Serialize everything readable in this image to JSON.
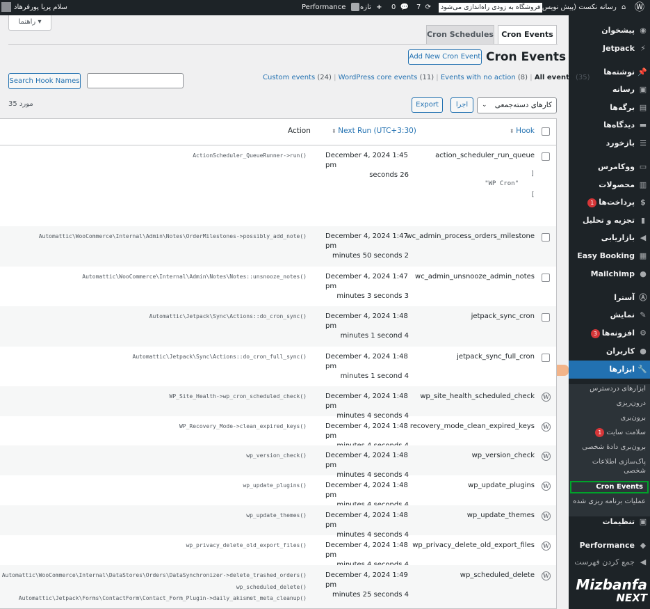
{
  "admin_bar": {
    "greeting": "سلام پریا پورفرهاد",
    "performance": "Performance",
    "new_label": "تازه",
    "comments_count": "0",
    "updates_count": "7",
    "notice": "فروشگاه به زودی راه‌اندازی می‌شود",
    "site_name": "رسانه نکست (پیش نویس)"
  },
  "menu": {
    "items": [
      {
        "label": "پیشخوان",
        "icon": "dashboard-icon"
      },
      {
        "label": "Jetpack",
        "icon": "jetpack-icon"
      },
      {
        "label": "نوشته‌ها",
        "icon": "pin-icon"
      },
      {
        "label": "رسانه",
        "icon": "media-icon"
      },
      {
        "label": "برگه‌ها",
        "icon": "pages-icon"
      },
      {
        "label": "دیدگاه‌ها",
        "icon": "comments-icon"
      },
      {
        "label": "بازخورد",
        "icon": "feedback-icon"
      },
      {
        "label": "ووکامرس",
        "icon": "woo-icon"
      },
      {
        "label": "محصولات",
        "icon": "products-icon"
      },
      {
        "label": "پرداخت‌ها",
        "icon": "payments-icon",
        "badge": "1"
      },
      {
        "label": "تجزیه و تحلیل",
        "icon": "analytics-icon"
      },
      {
        "label": "بازاریابی",
        "icon": "marketing-icon"
      },
      {
        "label": "Easy Booking",
        "icon": "calendar-icon"
      },
      {
        "label": "Mailchimp",
        "icon": "mailchimp-icon"
      },
      {
        "label": "آسترا",
        "icon": "astra-icon"
      },
      {
        "label": "نمایش",
        "icon": "brush-icon"
      },
      {
        "label": "افزونه‌ها",
        "icon": "plugins-icon",
        "badge": "3"
      },
      {
        "label": "کاربران",
        "icon": "users-icon"
      },
      {
        "label": "ابزارها",
        "icon": "tools-icon"
      },
      {
        "label": "تنظیمات",
        "icon": "settings-icon"
      },
      {
        "label": "Performance",
        "icon": "performance-icon"
      },
      {
        "label": "جمع کردن فهرست",
        "icon": "collapse-icon"
      }
    ],
    "submenu": [
      {
        "label": "ابزارهای دردسترس"
      },
      {
        "label": "درون‌ریزی"
      },
      {
        "label": "برون‌بری"
      },
      {
        "label": "سلامت سایت",
        "badge": "1"
      },
      {
        "label": "برون‌بری دادهٔ شخصی"
      },
      {
        "label": "پاک‌سازی اطلاعات شخصی"
      },
      {
        "label": "Cron Events"
      },
      {
        "label": "عملیات برنامه ریزی شده"
      }
    ],
    "logo_line1": "Mizbanfa",
    "logo_line2": "NEXT"
  },
  "page": {
    "help_label": "راهنما ▾",
    "tabs": [
      "Cron Events",
      "Cron Schedules"
    ],
    "title": "Cron Events",
    "add_new": "Add New Cron Event",
    "filters": [
      {
        "label": "All events",
        "count": "(35)"
      },
      {
        "label": "Events with no action",
        "count": "(8)"
      },
      {
        "label": "WordPress core events",
        "count": "(11)"
      },
      {
        "label": "Custom events",
        "count": "(24)"
      }
    ],
    "search_button": "Search Hook Names",
    "search_value": "",
    "bulk_select": "کارهای دسته‌جمعی",
    "apply_button": "اجرا",
    "export_button": "Export",
    "items_count": "35 مورد"
  },
  "table": {
    "columns": {
      "hook": "Hook",
      "next_run": "Next Run (UTC+3:30)",
      "action": "Action"
    },
    "args": [
      "]",
      "\"WP Cron\"",
      "["
    ],
    "rows": [
      {
        "hook": "action_scheduler_run_queue",
        "date": "December 4, 2024 1:45 pm",
        "rel": "seconds 26",
        "action": "ActionScheduler_QueueRunner->run()",
        "type": "checkbox"
      },
      {
        "hook": "wc_admin_process_orders_milestone",
        "date": "December 4, 2024 1:47 pm",
        "rel": "minutes 50 seconds 2",
        "action": "Automattic\\WooCommerce\\Internal\\Admin\\Notes\\OrderMilestones->possibly_add_note()",
        "type": "checkbox"
      },
      {
        "hook": "wc_admin_unsnooze_admin_notes",
        "date": "December 4, 2024 1:47 pm",
        "rel": "minutes 3 seconds 3",
        "action": "Automattic\\WooCommerce\\Internal\\Admin\\Notes\\Notes::unsnooze_notes()",
        "type": "checkbox"
      },
      {
        "hook": "jetpack_sync_cron",
        "date": "December 4, 2024 1:48 pm",
        "rel": "minutes 1 second 4",
        "action": "Automattic\\Jetpack\\Sync\\Actions::do_cron_sync()",
        "type": "checkbox"
      },
      {
        "hook": "jetpack_sync_full_cron",
        "date": "December 4, 2024 1:48 pm",
        "rel": "minutes 1 second 4",
        "action": "Automattic\\Jetpack\\Sync\\Actions::do_cron_full_sync()",
        "type": "checkbox"
      },
      {
        "hook": "wp_site_health_scheduled_check",
        "date": "December 4, 2024 1:48 pm",
        "rel": "minutes 4 seconds 4",
        "action": "WP_Site_Health->wp_cron_scheduled_check()",
        "type": "wp"
      },
      {
        "hook": "recovery_mode_clean_expired_keys",
        "date": "December 4, 2024 1:48 pm",
        "rel": "minutes 4 seconds 4",
        "action": "WP_Recovery_Mode->clean_expired_keys()",
        "type": "wp"
      },
      {
        "hook": "wp_version_check",
        "date": "December 4, 2024 1:48 pm",
        "rel": "minutes 4 seconds 4",
        "action": "wp_version_check()",
        "type": "wp"
      },
      {
        "hook": "wp_update_plugins",
        "date": "December 4, 2024 1:48 pm",
        "rel": "minutes 4 seconds 4",
        "action": "wp_update_plugins()",
        "type": "wp"
      },
      {
        "hook": "wp_update_themes",
        "date": "December 4, 2024 1:48 pm",
        "rel": "minutes 4 seconds 4",
        "action": "wp_update_themes()",
        "type": "wp"
      },
      {
        "hook": "wp_privacy_delete_old_export_files",
        "date": "December 4, 2024 1:48 pm",
        "rel": "minutes 4 seconds 4",
        "action": "wp_privacy_delete_old_export_files()",
        "type": "wp"
      },
      {
        "hook": "wp_scheduled_delete",
        "date": "December 4, 2024 1:49 pm",
        "rel": "minutes 25 seconds 4",
        "action": "Automattic\\WooCommerce\\Internal\\DataStores\\Orders\\DataSynchronizer->delete_trashed_orders()",
        "action2": "wp_scheduled_delete()",
        "action3": "Automattic\\Jetpack\\Forms\\ContactForm\\Contact_Form_Plugin->daily_akismet_meta_cleanup()",
        "type": "wp"
      }
    ]
  }
}
